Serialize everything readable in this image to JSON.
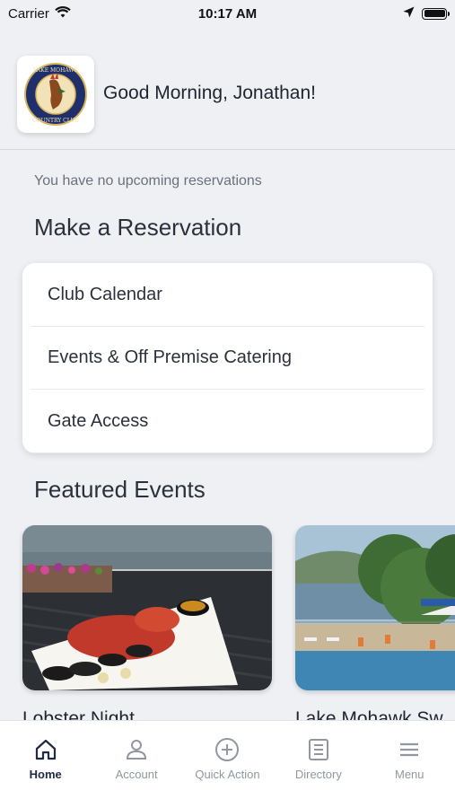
{
  "status_bar": {
    "carrier": "Carrier",
    "time": "10:17 AM"
  },
  "header": {
    "greeting": "Good Morning, Jonathan!",
    "logo_text": "LAKE MOHAWK COUNTRY CLUB"
  },
  "reservations": {
    "empty_message": "You have no upcoming reservations"
  },
  "make_reservation": {
    "title": "Make a Reservation",
    "items": [
      {
        "label": "Club Calendar"
      },
      {
        "label": "Events & Off Premise Catering"
      },
      {
        "label": "Gate Access"
      }
    ]
  },
  "featured_events": {
    "title": "Featured Events",
    "items": [
      {
        "title": "Lobster Night"
      },
      {
        "title": "Lake Mohawk Sw"
      }
    ]
  },
  "tabbar": {
    "items": [
      {
        "label": "Home",
        "icon": "home-icon",
        "active": true
      },
      {
        "label": "Account",
        "icon": "account-icon",
        "active": false
      },
      {
        "label": "Quick Action",
        "icon": "plus-circle-icon",
        "active": false
      },
      {
        "label": "Directory",
        "icon": "directory-icon",
        "active": false
      },
      {
        "label": "Menu",
        "icon": "menu-icon",
        "active": false
      }
    ]
  },
  "colors": {
    "background": "#eef0f4",
    "active_tab": "#1f2a44",
    "inactive_tab": "#9097a1"
  }
}
